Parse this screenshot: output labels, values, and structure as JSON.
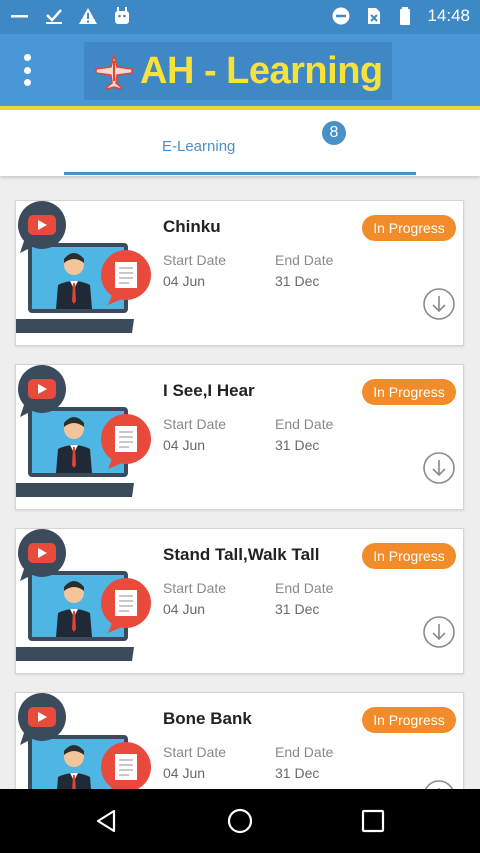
{
  "status_bar": {
    "time": "14:48",
    "icons": [
      "dash-icon",
      "checkmark-icon",
      "warning-icon",
      "android-icon",
      "do-not-disturb-icon",
      "no-sim-icon",
      "battery-icon"
    ]
  },
  "app_bar": {
    "menu_icon": "more-vert-icon",
    "logo_icon": "airplane-logo-icon",
    "title": "AH - Learning"
  },
  "tabs": [
    {
      "label": "E-Learning",
      "badge": "8"
    }
  ],
  "courses": [
    {
      "title": "Chinku",
      "status": "In Progress",
      "start_label": "Start Date",
      "start": "04 Jun",
      "end_label": "End Date",
      "end": "31 Dec"
    },
    {
      "title": "I See,I Hear",
      "status": "In Progress",
      "start_label": "Start Date",
      "start": "04 Jun",
      "end_label": "End Date",
      "end": "31 Dec"
    },
    {
      "title": "Stand Tall,Walk Tall",
      "status": "In Progress",
      "start_label": "Start Date",
      "start": "04 Jun",
      "end_label": "End Date",
      "end": "31 Dec"
    },
    {
      "title": "Bone Bank",
      "status": "In Progress",
      "start_label": "Start Date",
      "start": "04 Jun",
      "end_label": "End Date",
      "end": "31 Dec"
    }
  ],
  "nav_bar": {
    "icons": [
      "back-icon",
      "home-icon",
      "recents-icon"
    ]
  },
  "colors": {
    "primary": "#4a97d8",
    "status_bar": "#3f88c6",
    "logo_text": "#f7e23a",
    "accent": "#4a90c8",
    "status_pill": "#f28c2b"
  }
}
